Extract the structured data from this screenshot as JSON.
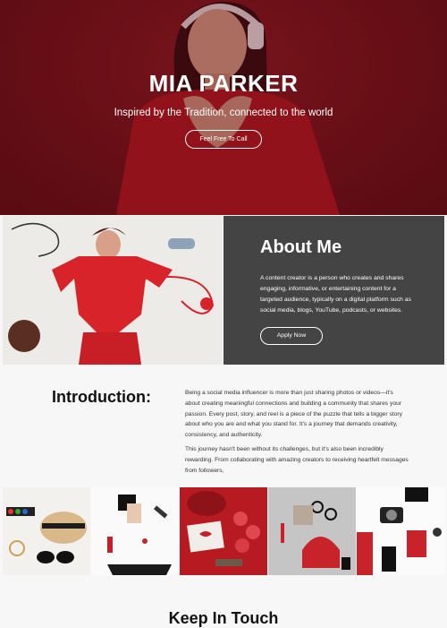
{
  "hero": {
    "name": "MIA PARKER",
    "tagline": "Inspired by the Tradition, connected to the world",
    "button_label": "Feel Free To Call"
  },
  "about": {
    "title": "About Me",
    "text": "A content creator is a person who creates and shares engaging, informative, or entertaining content for a targeted audience, typically on a digital platform such as social media, blogs, YouTube, podcasts, or websites.",
    "button_label": "Apply Now"
  },
  "intro": {
    "title": "Introduction:",
    "paragraphs": [
      "Being a social media influencer is more than just sharing photos or videos—it's about creating meaningful connections and building a community that shares your passion. Every post, story, and reel is a piece of the puzzle that tells a bigger story about who you are and what you stand for. It's a journey that demands creativity, consistency, and authenticity.",
      "This journey hasn't been without its challenges, but it's also been incredibly rewarding. From collaborating with amazing creators to receiving heartfelt messages from followers,"
    ]
  },
  "footer": {
    "title": "Keep In Touch"
  },
  "colors": {
    "hero_red": "#6e1219",
    "panel_gray": "#444444",
    "accent_red": "#d8232a"
  }
}
